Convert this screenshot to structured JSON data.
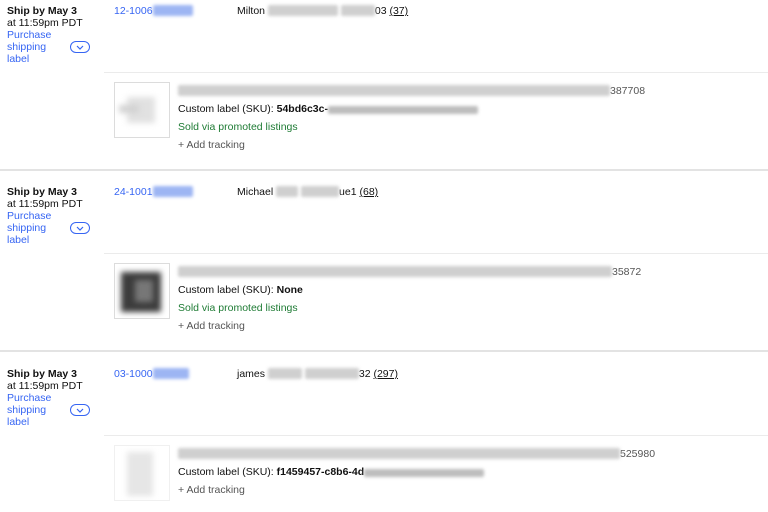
{
  "orders": [
    {
      "ship_by": "Ship by May 3",
      "ship_time": "at 11:59pm PDT",
      "purchase_label": "Purchase shipping label",
      "order_id_prefix": "12-1006",
      "buyer_name": "Milton",
      "buyer_id_suffix": "03",
      "feedback": "(37)",
      "item_number_suffix": "387708",
      "sku_label": "Custom label (SKU):",
      "sku_value": "54bd6c3c-",
      "promoted": "Sold via promoted listings",
      "add_tracking": "+ Add tracking"
    },
    {
      "ship_by": "Ship by May 3",
      "ship_time": "at 11:59pm PDT",
      "purchase_label": "Purchase shipping label",
      "order_id_prefix": "24-1001",
      "buyer_name": "Michael",
      "buyer_id_suffix": "ue1",
      "feedback": "(68)",
      "item_number_suffix": "35872",
      "sku_label": "Custom label (SKU):",
      "sku_value": "None",
      "promoted": "Sold via promoted listings",
      "add_tracking": "+ Add tracking"
    },
    {
      "ship_by": "Ship by May 3",
      "ship_time": "at 11:59pm PDT",
      "purchase_label": "Purchase shipping label",
      "order_id_prefix": "03-1000",
      "buyer_name": "james",
      "buyer_id_suffix": "32",
      "feedback": "(297)",
      "item_number_suffix": "525980",
      "sku_label": "Custom label (SKU):",
      "sku_value": "f1459457-c8b6-4d",
      "promoted": "",
      "add_tracking": "+ Add tracking"
    }
  ],
  "icons": {
    "expand": "chevron-down-icon"
  },
  "colors": {
    "link": "#3665f3",
    "promoted": "#1e7b34"
  }
}
